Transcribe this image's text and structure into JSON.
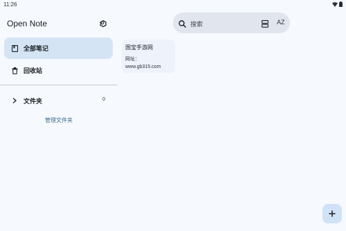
{
  "status_bar": {
    "time": "11:26"
  },
  "sidebar": {
    "title": "Open Note",
    "items": [
      {
        "label": "全部笔记",
        "icon": "note-book-icon",
        "active": true
      },
      {
        "label": "回收站",
        "icon": "trash-icon",
        "active": false
      }
    ],
    "folders": {
      "label": "文件夹",
      "count": "0"
    },
    "manage_label": "管理文件夹"
  },
  "search": {
    "placeholder": "搜索",
    "sort_label": "AZ"
  },
  "notes": [
    {
      "title": "国宝手游网",
      "body_line1": "网址：",
      "body_line2": "www.gb315.com"
    }
  ],
  "colors": {
    "background": "#f6f9fe",
    "active_nav": "#d4e4f5",
    "search_bg": "#e1e6ee",
    "fab_bg": "#cfe2f6",
    "link": "#3a6d8c"
  }
}
